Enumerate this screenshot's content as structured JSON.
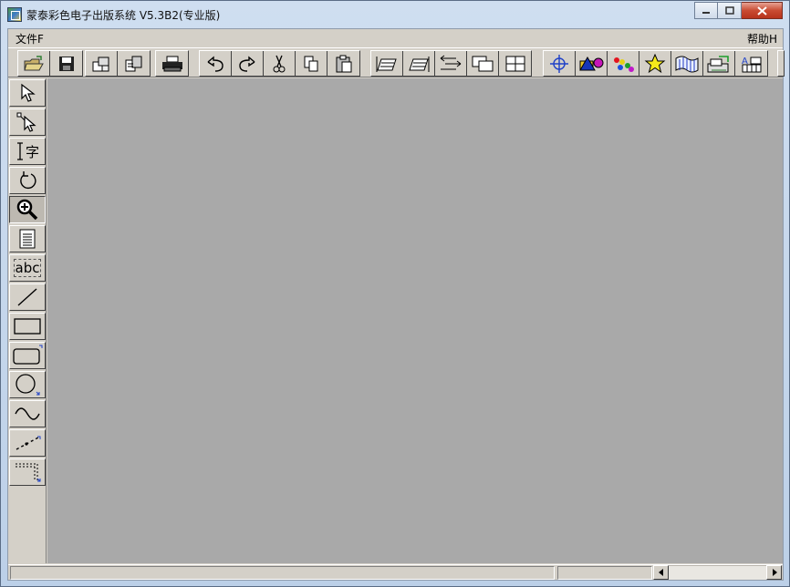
{
  "window": {
    "title": "蒙泰彩色电子出版系统 V5.3B2(专业版)",
    "icon": "app-icon",
    "controls": [
      "minimize-icon",
      "maximize-icon",
      "close-icon"
    ]
  },
  "menubar": {
    "items": [
      {
        "label": "文件F"
      },
      {
        "label": "帮助H"
      }
    ]
  },
  "toolbar": {
    "groups": [
      [
        "open-folder-icon",
        "save-disk-icon"
      ],
      [
        "page-setup-icon",
        "page-properties-icon"
      ],
      [
        "print-icon"
      ],
      [
        "undo-icon",
        "redo-icon",
        "cut-icon",
        "copy-icon",
        "paste-icon"
      ],
      [
        "insert-page-icon",
        "delete-page-icon",
        "page-swap-icon",
        "overlap-pages-icon",
        "split-window-icon"
      ],
      [
        "crosshair-icon",
        "shapes-color-icon",
        "color-palette-icon",
        "star-icon",
        "texture-icon",
        "image-import-icon",
        "text-grid-icon"
      ]
    ]
  },
  "side_tools": [
    {
      "name": "select-tool",
      "icon": "arrow-pointer-icon"
    },
    {
      "name": "node-edit-tool",
      "icon": "node-pointer-icon"
    },
    {
      "name": "text-cursor-tool",
      "icon": "text-cursor-icon",
      "label": "字"
    },
    {
      "name": "rotate-tool",
      "icon": "rotate-icon"
    },
    {
      "name": "zoom-tool",
      "icon": "magnifier-icon",
      "active": true
    },
    {
      "name": "page-tool",
      "icon": "page-icon"
    },
    {
      "name": "text-block-tool",
      "icon": "text-block-icon",
      "label": "abc"
    },
    {
      "name": "line-tool",
      "icon": "line-icon"
    },
    {
      "name": "rectangle-tool",
      "icon": "rectangle-icon"
    },
    {
      "name": "rounded-rectangle-tool",
      "icon": "rounded-rectangle-icon"
    },
    {
      "name": "ellipse-tool",
      "icon": "ellipse-icon"
    },
    {
      "name": "curve-tool",
      "icon": "curve-icon"
    },
    {
      "name": "polyline-tool",
      "icon": "dashed-line-icon"
    },
    {
      "name": "table-tool",
      "icon": "table-corner-icon"
    }
  ],
  "colors": {
    "canvas": "#a9a9a9",
    "chrome": "#d4d0c8",
    "title_gradient_top": "#cfdef0",
    "close_button": "#c94b32"
  }
}
